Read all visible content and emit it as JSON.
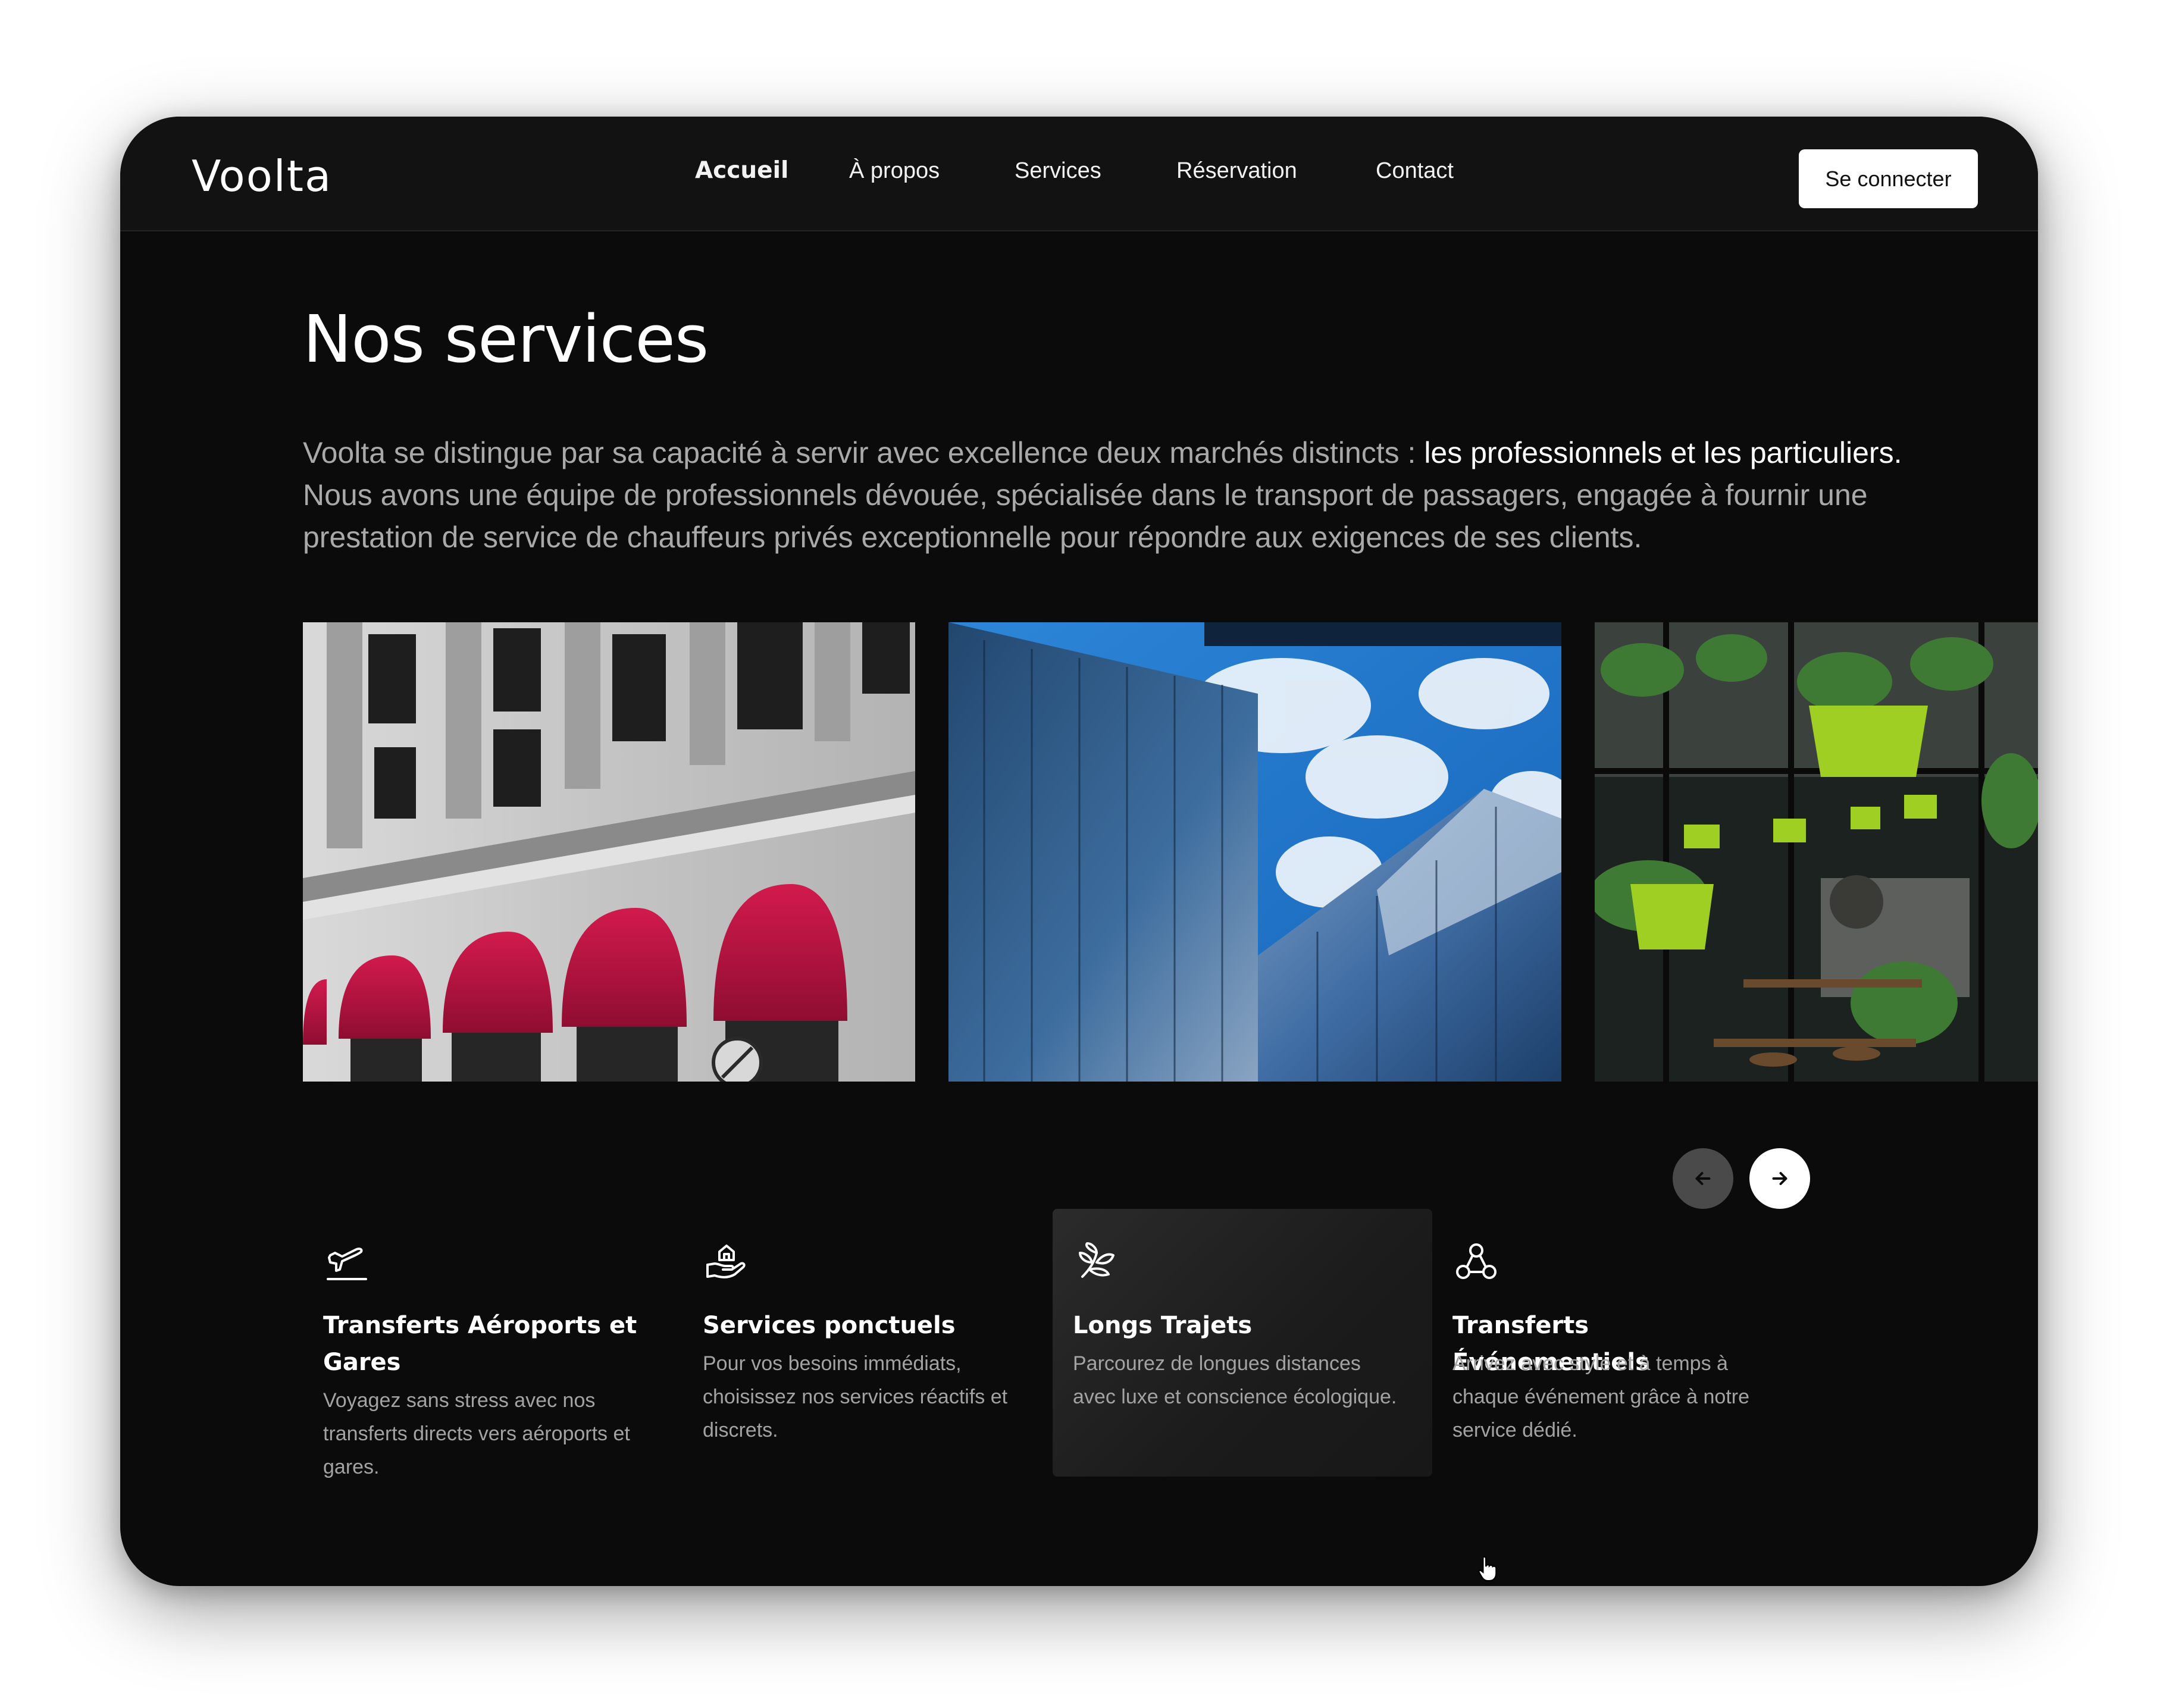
{
  "nav": {
    "logo": "Voolta",
    "links": [
      "Accueil",
      "À propos",
      "Services",
      "Réservation",
      "Contact"
    ],
    "active": "Accueil",
    "login_label": "Se connecter"
  },
  "main": {
    "title": "Nos services",
    "intro_part1": "Voolta se distingue par sa capacité à servir avec excellence deux marchés distincts : ",
    "intro_highlight": "les professionnels et les particuliers.",
    "intro_part2": " Nous avons une équipe de professionnels dévouée, spécialisée dans le transport de passagers, engagée à fournir une prestation de service de chauffeurs privés exceptionnelle pour répondre aux exigences de ses clients."
  },
  "carousel": {
    "prev_icon": "arrow-left-icon",
    "next_icon": "arrow-right-icon"
  },
  "services": [
    {
      "icon": "plane-icon",
      "title": "Transferts Aéroports et Gares",
      "desc": "Voyagez sans stress avec nos transferts directs vers aéroports et gares."
    },
    {
      "icon": "hand-house-icon",
      "title": "Services ponctuels",
      "desc": "Pour vos besoins immédiats, choisissez nos services réactifs et discrets."
    },
    {
      "icon": "leaf-icon",
      "title": "Longs Trajets",
      "desc": "Parcourez de longues distances avec luxe et conscience écologique."
    },
    {
      "icon": "nodes-icon",
      "title": "Transferts Événementiels",
      "desc": "Arrivez avec style et à temps à chaque événement grâce à notre service dédié."
    }
  ],
  "colors": {
    "background": "#0b0b0b",
    "nav": "#121212",
    "text": "#ffffff",
    "muted": "#a9a9a9",
    "awning": "#b5123f"
  }
}
